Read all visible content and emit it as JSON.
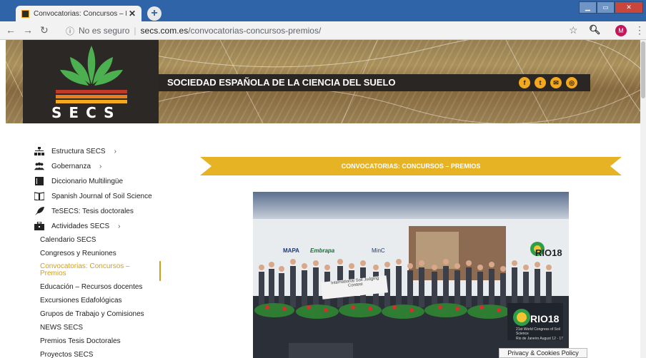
{
  "browser": {
    "tab_title": "Convocatorias: Concursos – Prem",
    "tab_close": "✕",
    "new_tab": "+",
    "security_label": "No es seguro",
    "url_host": "secs.com.es",
    "url_path": "/convocatorias-concursos-premios/",
    "profile_initial": "M"
  },
  "header": {
    "logo_text": "SECS",
    "site_title": "SOCIEDAD ESPAÑOLA DE LA CIENCIA DEL SUELO",
    "social_icons": [
      "facebook-icon",
      "twitter-icon",
      "email-icon",
      "instagram-icon"
    ],
    "accent_color": "#f4a81d"
  },
  "sidebar": {
    "items": [
      {
        "label": "Estructura SECS",
        "icon": "org-chart-icon",
        "has_submenu": true
      },
      {
        "label": "Gobernanza",
        "icon": "group-icon",
        "has_submenu": true
      },
      {
        "label": "Diccionario Multilingüe",
        "icon": "book-icon",
        "has_submenu": false
      },
      {
        "label": "Spanish Journal of Soil Science",
        "icon": "open-book-icon",
        "has_submenu": false
      },
      {
        "label": "TeSECS: Tesis doctorales",
        "icon": "feather-icon",
        "has_submenu": false
      },
      {
        "label": "Actividades SECS",
        "icon": "briefcase-icon",
        "has_submenu": true
      }
    ],
    "subitems": [
      {
        "label": "Calendario SECS"
      },
      {
        "label": "Congresos y Reuniones"
      },
      {
        "label": "Convocatorias: Concursos – Premios",
        "active": true
      },
      {
        "label": "Educación – Recursos docentes"
      },
      {
        "label": "Excursiones Edafológicas"
      },
      {
        "label": "Grupos de Trabajo y Comisiones"
      },
      {
        "label": "NEWS SECS"
      },
      {
        "label": "Premios Tesis Doctorales"
      },
      {
        "label": "Proyectos SECS"
      }
    ],
    "chevron": "›",
    "active_color": "#d4a017"
  },
  "main": {
    "ribbon_title": "CONVOCATORIAS: CONCURSOS – PREMIOS",
    "ribbon_color": "#e6b325",
    "photo": {
      "banner_logo_1": "MAPA",
      "banner_logo_2": "Embrapa",
      "banner_logo_3": "MinC",
      "banner_center_text": "International Soil Judging Contest",
      "event_logo": "RIO18",
      "event_subtitle": "21st World Congress of Soil Science",
      "event_dates": "Rio de Janeiro August 12 - 17"
    }
  },
  "cookie_notice": "Privacy & Cookies Policy"
}
